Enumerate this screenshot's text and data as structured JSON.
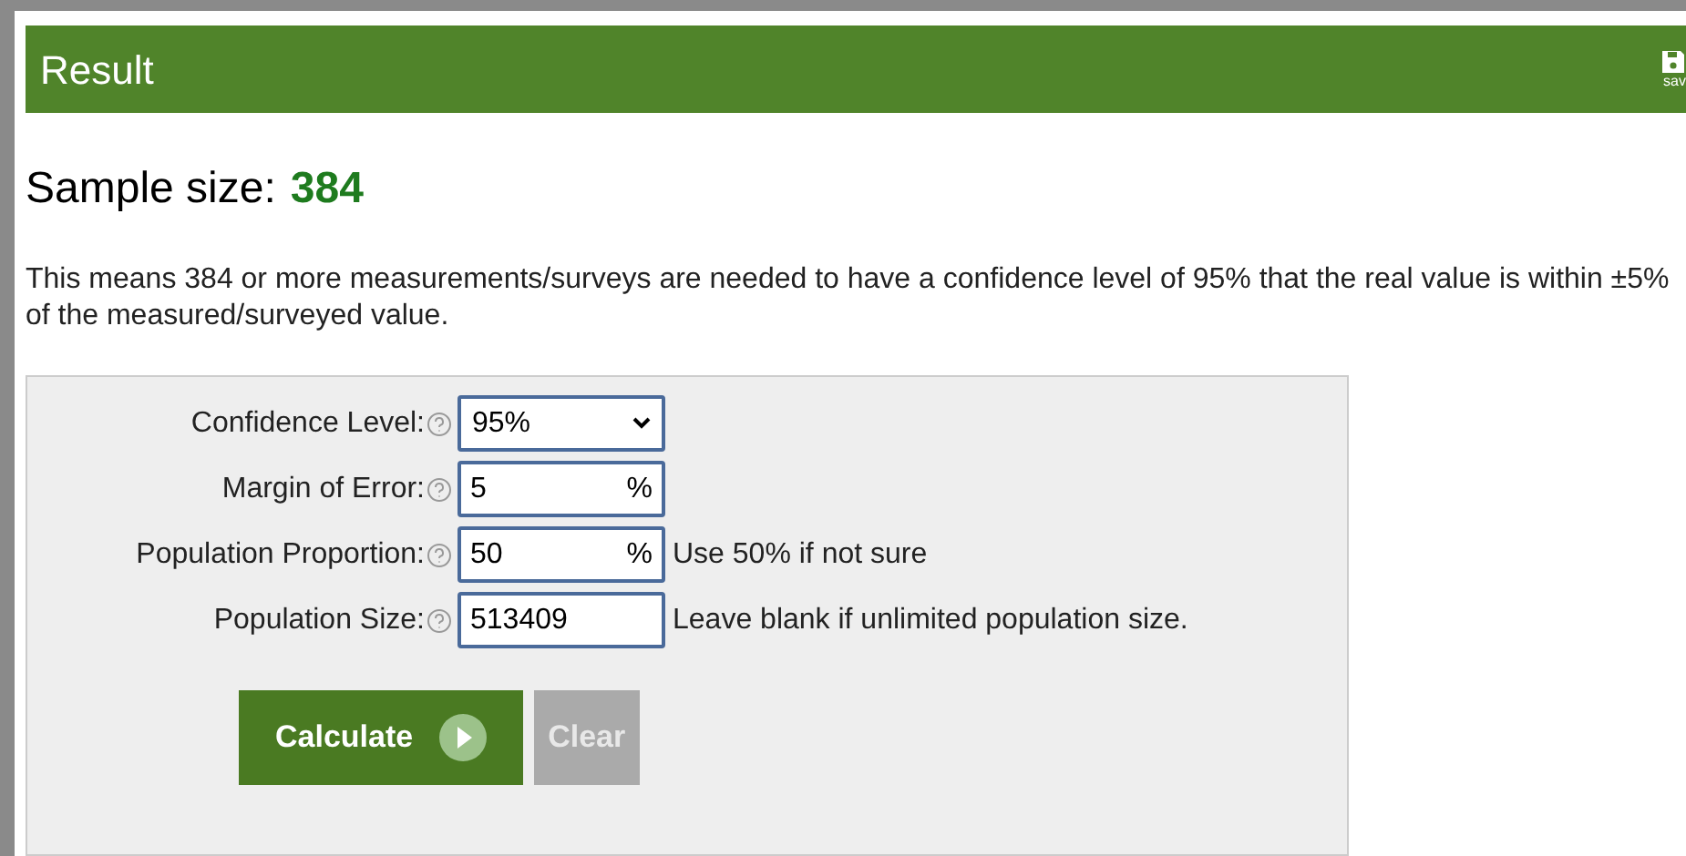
{
  "header": {
    "title": "Result",
    "save_label": "sav"
  },
  "result": {
    "label": "Sample size:",
    "value": "384"
  },
  "explanation": "This means 384 or more measurements/surveys are needed to have a confidence level of 95% that the real value is within ±5% of the measured/surveyed value.",
  "form": {
    "fields": [
      {
        "kind": "select",
        "label": "Confidence Level:",
        "value": "95%"
      },
      {
        "kind": "input",
        "label": "Margin of Error:",
        "value": "5",
        "unit": "%"
      },
      {
        "kind": "input",
        "label": "Population Proportion:",
        "value": "50",
        "unit": "%",
        "note": "Use 50% if not sure"
      },
      {
        "kind": "input",
        "label": "Population Size:",
        "value": "513409",
        "note": "Leave blank if unlimited population size."
      }
    ],
    "buttons": [
      {
        "kind": "primary",
        "label": "Calculate"
      },
      {
        "kind": "secondary",
        "label": "Clear"
      }
    ]
  }
}
